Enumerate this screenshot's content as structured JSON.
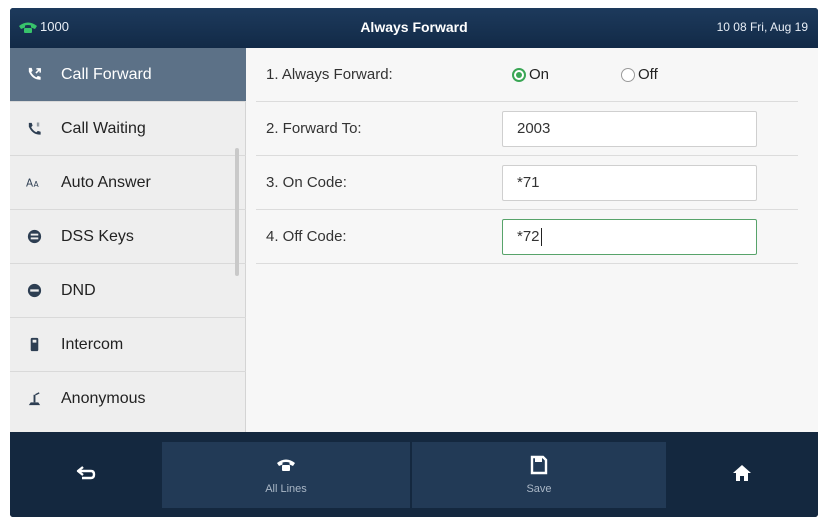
{
  "statusbar": {
    "line": "1000",
    "title": "Always Forward",
    "datetime": "10 08 Fri, Aug 19",
    "line_icon": "phone-handset-icon",
    "line_icon_color": "#38c36b"
  },
  "sidebar": {
    "items": [
      {
        "label": "Call Forward",
        "icon": "call-forward-icon",
        "active": true
      },
      {
        "label": "Call Waiting",
        "icon": "call-waiting-icon",
        "active": false
      },
      {
        "label": "Auto Answer",
        "icon": "auto-answer-icon",
        "active": false
      },
      {
        "label": "DSS Keys",
        "icon": "dss-keys-icon",
        "active": false
      },
      {
        "label": "DND",
        "icon": "dnd-icon",
        "active": false
      },
      {
        "label": "Intercom",
        "icon": "intercom-icon",
        "active": false
      },
      {
        "label": "Anonymous",
        "icon": "anonymous-icon",
        "active": false
      }
    ]
  },
  "form": {
    "always_forward": {
      "label": "1. Always Forward:",
      "option_on": "On",
      "option_off": "Off",
      "selected": "On"
    },
    "forward_to": {
      "label": "2. Forward To:",
      "value": "2003"
    },
    "on_code": {
      "label": "3. On Code:",
      "value": "*71"
    },
    "off_code": {
      "label": "4. Off Code:",
      "value": "*72"
    }
  },
  "softkeys": {
    "back": {
      "icon": "back-arrow-icon"
    },
    "all_lines": {
      "label": "All Lines",
      "icon": "phone-icon"
    },
    "save": {
      "label": "Save",
      "icon": "save-icon"
    },
    "home": {
      "icon": "home-icon"
    }
  },
  "colors": {
    "accent_green": "#3aa655",
    "sidebar_active": "#5c7187",
    "softbar_bg": "#14283f"
  }
}
